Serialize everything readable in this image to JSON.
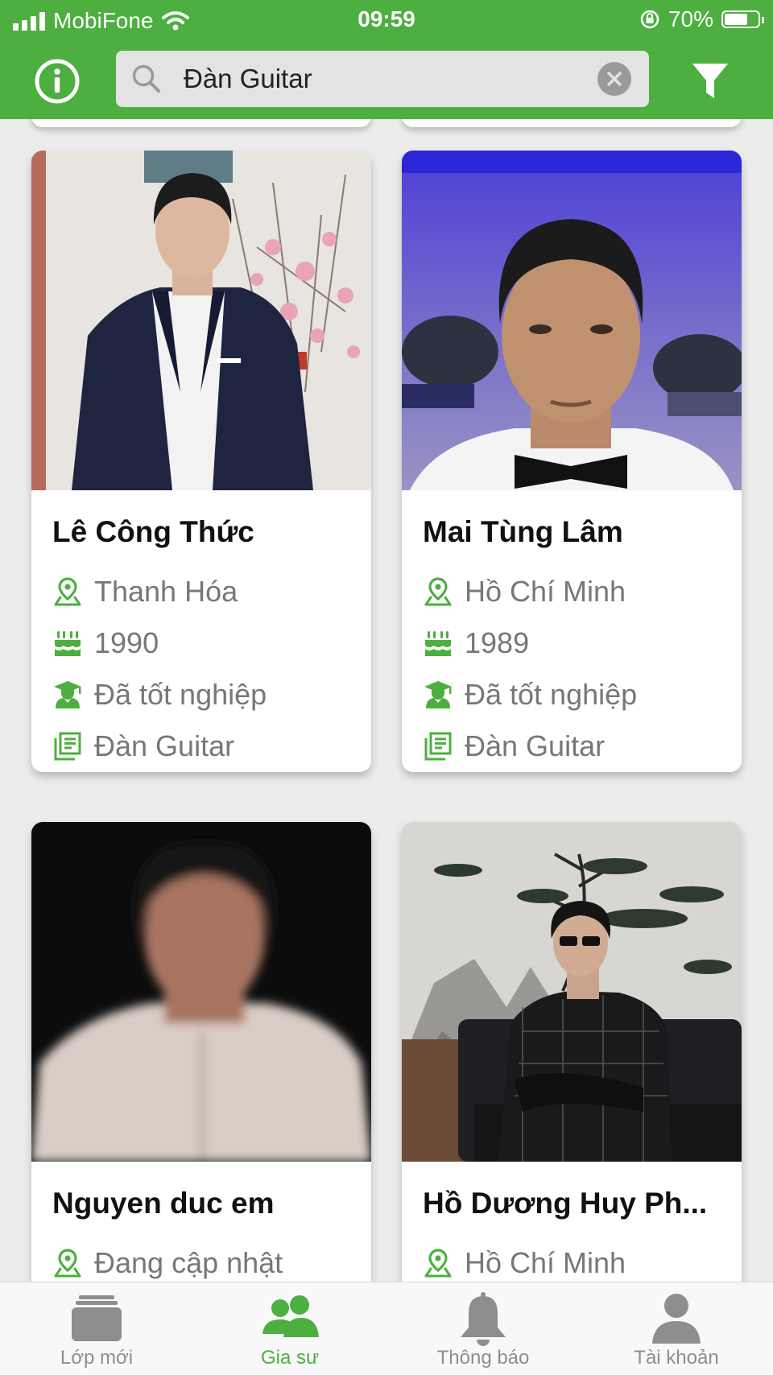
{
  "status_bar": {
    "carrier": "MobiFone",
    "time": "09:59",
    "battery_text": "70%",
    "battery_level": 0.7
  },
  "search": {
    "value": "Đàn Guitar",
    "placeholder": ""
  },
  "tutors": [
    {
      "name": "Lê Công Thức",
      "location": "Thanh Hóa",
      "birth_year": "1990",
      "education": "Đã tốt nghiệp",
      "subject": "Đàn Guitar"
    },
    {
      "name": "Mai Tùng Lâm",
      "location": "Hồ Chí Minh",
      "birth_year": "1989",
      "education": "Đã tốt nghiệp",
      "subject": "Đàn Guitar"
    },
    {
      "name": "Nguyen duc em",
      "location": "Đang cập nhật"
    },
    {
      "name": "Hồ Dương Huy Ph...",
      "location": "Hồ Chí Minh"
    }
  ],
  "tabs": [
    {
      "label": "Lớp mới",
      "icon": "stack-icon"
    },
    {
      "label": "Gia sư",
      "icon": "people-icon"
    },
    {
      "label": "Thông báo",
      "icon": "bell-icon"
    },
    {
      "label": "Tài khoản",
      "icon": "person-icon"
    }
  ],
  "colors": {
    "primary": "#4caf3f",
    "inactive_tab": "#8e8e8e",
    "text_secondary": "#777777"
  }
}
